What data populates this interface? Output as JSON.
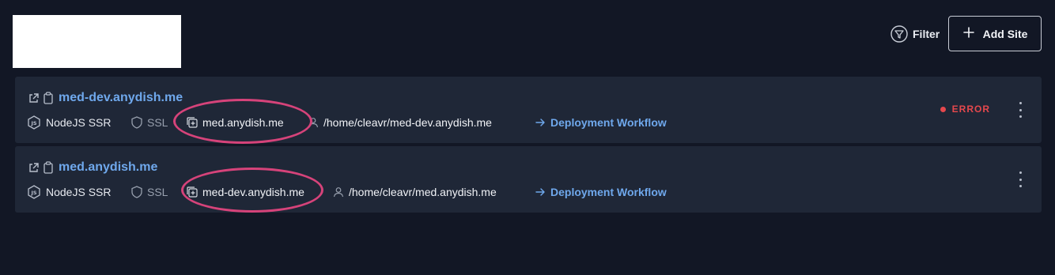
{
  "header": {
    "filter_label": "Filter",
    "add_site_label": "Add Site"
  },
  "sites": [
    {
      "name": "med-dev.anydish.me",
      "type": "NodeJS SSR",
      "ssl": "SSL",
      "domain": "med.anydish.me",
      "path": "/home/cleavr/med-dev.anydish.me",
      "workflow": "Deployment Workflow",
      "status": "ERROR"
    },
    {
      "name": "med.anydish.me",
      "type": "NodeJS SSR",
      "ssl": "SSL",
      "domain": "med-dev.anydish.me",
      "path": "/home/cleavr/med.anydish.me",
      "workflow": "Deployment Workflow"
    }
  ],
  "colors": {
    "background": "#121725",
    "card": "#1f2737",
    "link": "#6fa8ec",
    "error": "#e5484d",
    "annotation": "#d6437a"
  }
}
